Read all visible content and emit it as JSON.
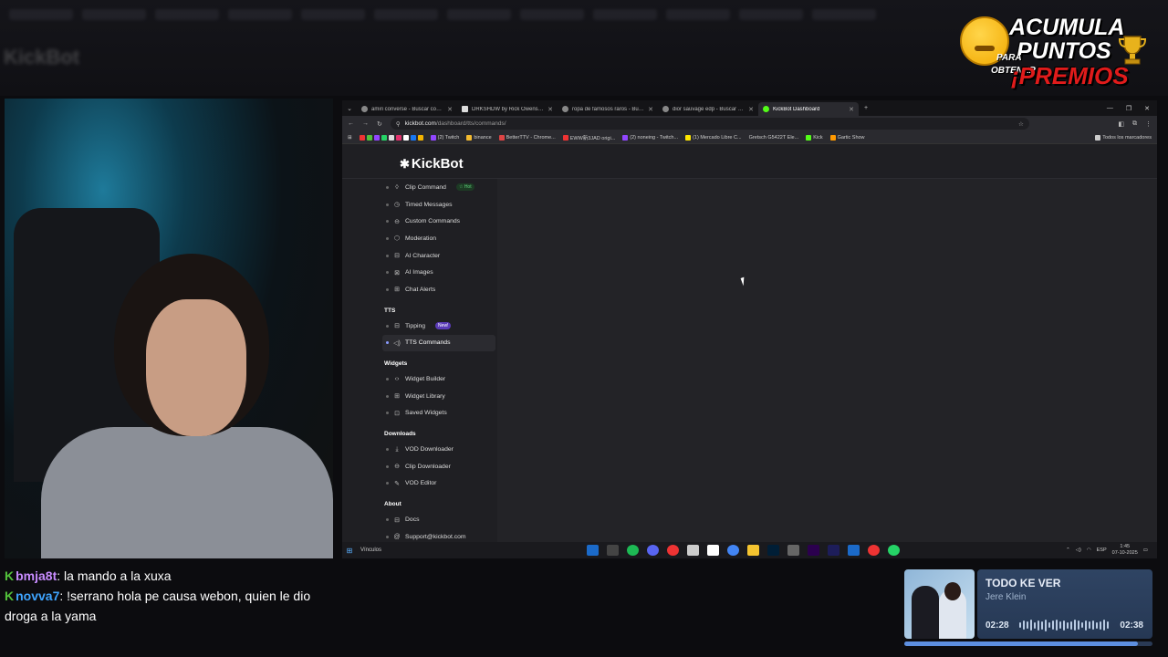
{
  "promo": {
    "line1": "ACUMULA",
    "line2": "PUNTOS",
    "small1": "PARA",
    "small2": "OBTENER",
    "line3": "¡PREMIOS"
  },
  "browser": {
    "tabs": [
      {
        "label": "amiri converse - Buscar con Go",
        "active": false
      },
      {
        "label": "DRKSHDW by Rick Owens ZAP",
        "active": false
      },
      {
        "label": "ropa de famosos raros - Buscar",
        "active": false
      },
      {
        "label": "dior sauvage edp - Buscar con",
        "active": false
      },
      {
        "label": "KickBot Dashboard",
        "active": true
      }
    ],
    "url_host": "kickbot.com",
    "url_path": "/dashboard/tts/commands/",
    "bookmarks": [
      "(2) Twitch",
      "binance",
      "BetterTTV - Chrome...",
      "EWW新3JAD origi...",
      "(2) noneing - Twitch...",
      "(1) Mercado Libre C...",
      "Gretsch G5422T Ele...",
      "Kick",
      "Gartic Show"
    ],
    "bookmarks_all": "Todos los marcadores"
  },
  "kickbot": {
    "logo": "KickBot",
    "sections": [
      {
        "title": "",
        "items": [
          {
            "label": "Clip Command",
            "icon": "clip-icon",
            "glyph": "◊",
            "badge": "☆ Hot"
          },
          {
            "label": "Timed Messages",
            "icon": "clock-icon",
            "glyph": "◷"
          },
          {
            "label": "Custom Commands",
            "icon": "commands-icon",
            "glyph": "⊖"
          },
          {
            "label": "Moderation",
            "icon": "shield-icon",
            "glyph": "⬡"
          },
          {
            "label": "AI Character",
            "icon": "robot-icon",
            "glyph": "⊟"
          },
          {
            "label": "AI Images",
            "icon": "image-icon",
            "glyph": "⊠"
          },
          {
            "label": "Chat Alerts",
            "icon": "alert-icon",
            "glyph": "⊞"
          }
        ]
      },
      {
        "title": "TTS",
        "items": [
          {
            "label": "Tipping",
            "icon": "tip-icon",
            "glyph": "⊟",
            "badge": "New!"
          },
          {
            "label": "TTS Commands",
            "icon": "speaker-icon",
            "glyph": "◁)",
            "active": true
          }
        ]
      },
      {
        "title": "Widgets",
        "items": [
          {
            "label": "Widget Builder",
            "icon": "code-icon",
            "glyph": "‹›"
          },
          {
            "label": "Widget Library",
            "icon": "grid-icon",
            "glyph": "⊞"
          },
          {
            "label": "Saved Widgets",
            "icon": "saved-icon",
            "glyph": "⊡"
          }
        ]
      },
      {
        "title": "Downloads",
        "items": [
          {
            "label": "VOD Downloader",
            "icon": "download-icon",
            "glyph": "⤓"
          },
          {
            "label": "Clip Downloader",
            "icon": "clip-download-icon",
            "glyph": "⊖"
          },
          {
            "label": "VOD Editor",
            "icon": "edit-icon",
            "glyph": "✎"
          }
        ]
      },
      {
        "title": "About",
        "items": [
          {
            "label": "Docs",
            "icon": "docs-icon",
            "glyph": "⊟"
          },
          {
            "label": "Support@kickbot.com",
            "icon": "mail-icon",
            "glyph": "@"
          }
        ]
      }
    ]
  },
  "taskbar": {
    "search": "Vínculos",
    "lang": "ESP",
    "time": "1:45",
    "date": "07-10-2025"
  },
  "chat": [
    {
      "user": "bmja8t",
      "text": ": la mando a la xuxa"
    },
    {
      "user": "novva7",
      "text": ": !serrano hola pe causa webon, quien le dio droga a la yama"
    }
  ],
  "music": {
    "song": "TODO KE VER",
    "artist": "Jere Klein",
    "elapsed": "02:28",
    "duration": "02:38",
    "progress": 0.94
  }
}
